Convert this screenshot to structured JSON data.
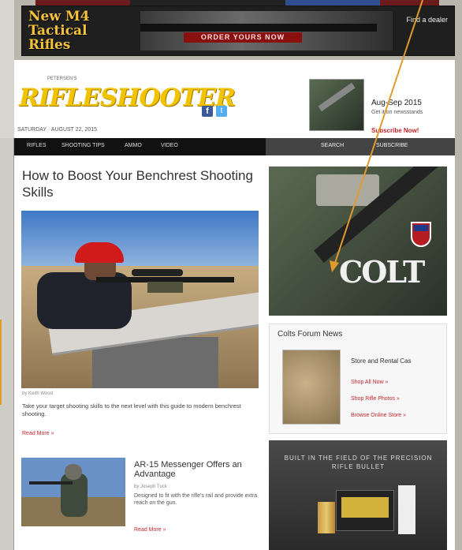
{
  "banner": {
    "headline": "New M4 Tactical Rifles",
    "red_text": "ORDER YOURS NOW",
    "right_text": "Find a dealer"
  },
  "header": {
    "logo": "RIFLESHOOTER",
    "logo_tag": "PETERSEN'S",
    "date": "SATURDAY · AUGUST 22, 2015",
    "facebook_glyph": "f",
    "twitter_glyph": "t",
    "magazine": {
      "title": "Aug-Sep 2015",
      "subtitle": "Get it on newsstands",
      "link": "Subscribe Now!"
    }
  },
  "nav": {
    "items": [
      "RIFLES",
      "SHOOTING TIPS",
      "AMMO",
      "VIDEO"
    ],
    "right_items": [
      "SEARCH",
      "SUBSCRIBE"
    ]
  },
  "article": {
    "title": "How to Boost Your Benchrest Shooting Skills",
    "byline": "by Keith Wood",
    "dek": "Take your target shooting skills to the next level with this guide to modern benchrest shooting.",
    "read_more": "Read More »"
  },
  "article2": {
    "title": "AR-15 Messenger Offers an Advantage",
    "byline": "by Joseph Tuck",
    "dek": "Designed to fit with the rifle's rail and provide extra reach on the gun.",
    "read_more": "Read More »"
  },
  "sidebar": {
    "colt_logo": "COLT",
    "forum": {
      "title": "Colts Forum News",
      "headline": "Store and Rental Cas",
      "links": [
        "Shop All Now »",
        "Shop Rifle Photos »",
        "Browse Online Store »"
      ]
    },
    "ammo_ad": {
      "text": "BUILT IN THE FIELD OF THE PRECISION RIFLE BULLET"
    }
  },
  "colors": {
    "logo_yellow": "#f2c300",
    "link_red": "#c0262c",
    "nav_black": "#111111",
    "annotation_orange": "#e39a2d"
  }
}
